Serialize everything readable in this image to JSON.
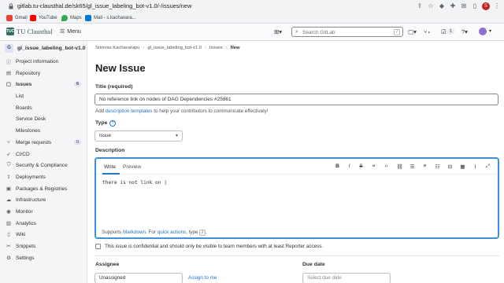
{
  "browser": {
    "url": "gitlab.tu-clausthal.de/sk65/gl_issue_labeling_bot-v1.0/-/issues/new",
    "profile_initial": "S",
    "bookmarks": [
      {
        "label": "Gmail",
        "color": "#ea4335"
      },
      {
        "label": "YouTube",
        "color": "#ff0000"
      },
      {
        "label": "Maps",
        "color": "#34a853"
      },
      {
        "label": "Mail - s.kachavara...",
        "color": "#0078d4"
      }
    ]
  },
  "header": {
    "brand": "TU Clausthal",
    "logo_text": "TUC",
    "menu_label": "Menu",
    "search_placeholder": "Search GitLab",
    "search_shortcut": "/",
    "todo_count": "1"
  },
  "sidebar": {
    "project_initial": "G",
    "project_name": "gl_issue_labeling_bot-v1.0",
    "items": [
      {
        "label": "Project information",
        "icon": "info-icon"
      },
      {
        "label": "Repository",
        "icon": "doc-icon"
      },
      {
        "label": "Issues",
        "icon": "issues-icon",
        "count": "6"
      },
      {
        "label": "List"
      },
      {
        "label": "Boards"
      },
      {
        "label": "Service Desk"
      },
      {
        "label": "Milestones"
      },
      {
        "label": "Merge requests",
        "icon": "merge-icon",
        "count": "0"
      },
      {
        "label": "CI/CD",
        "icon": "rocket-icon"
      },
      {
        "label": "Security & Compliance",
        "icon": "shield-icon"
      },
      {
        "label": "Deployments",
        "icon": "deploy-icon"
      },
      {
        "label": "Packages & Registries",
        "icon": "package-icon"
      },
      {
        "label": "Infrastructure",
        "icon": "cloud-icon"
      },
      {
        "label": "Monitor",
        "icon": "monitor-icon"
      },
      {
        "label": "Analytics",
        "icon": "chart-icon"
      },
      {
        "label": "Wiki",
        "icon": "book-icon"
      },
      {
        "label": "Snippets",
        "icon": "snippet-icon"
      },
      {
        "label": "Settings",
        "icon": "gear-icon"
      }
    ]
  },
  "breadcrumb": {
    "user": "Srinivas Kachavarapu",
    "project": "gl_issue_labeling_bot-v1.0",
    "section": "Issues",
    "current": "New"
  },
  "main": {
    "title": "New Issue",
    "title_label": "Title (required)",
    "title_value": "No reference link on nodes of DAG Dependencies #25861",
    "help_prefix": "Add ",
    "help_link": "description templates",
    "help_suffix": " to help your contributors to communicate effectively!",
    "type_label": "Type",
    "type_value": "Issue",
    "description_label": "Description",
    "tab_write": "Write",
    "tab_preview": "Preview",
    "description_value": "there is not link on |",
    "footer_prefix": "Supports ",
    "footer_markdown": "Markdown",
    "footer_mid": ". For ",
    "footer_quick": "quick actions",
    "footer_suffix": ", type ",
    "footer_key": "/",
    "footer_end": ".",
    "confidential_text": "This issue is confidential and should only be visible to team members with at least Reporter access.",
    "assignee_label": "Assignee",
    "assignee_value": "Unassigned",
    "assign_me": "Assign to me",
    "due_label": "Due date",
    "due_placeholder": "Select due date"
  }
}
